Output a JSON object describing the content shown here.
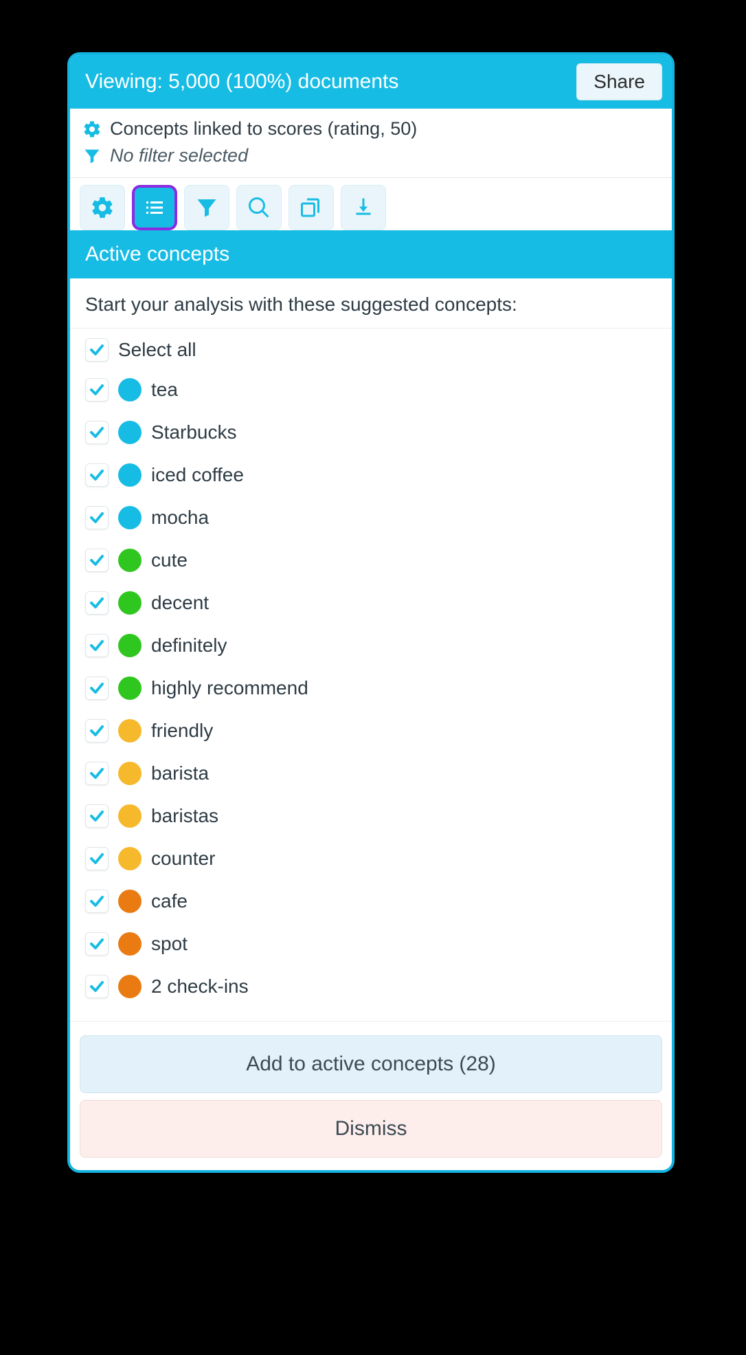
{
  "topbar": {
    "viewing_label": "Viewing: 5,000 (100%) documents",
    "share_label": "Share"
  },
  "status": {
    "concepts_linked": "Concepts linked to scores (rating, 50)",
    "filter": "No filter selected"
  },
  "section": {
    "title": "Active concepts",
    "intro": "Start your analysis with these suggested concepts:"
  },
  "select_all_label": "Select all",
  "footer": {
    "add_label": "Add to active concepts (28)",
    "dismiss_label": "Dismiss"
  },
  "colors": {
    "blue": "#17bce4",
    "green": "#2fc71f",
    "yellow": "#f5b92b",
    "orange": "#ea7b12"
  },
  "concepts": [
    {
      "label": "tea",
      "color": "blue"
    },
    {
      "label": "Starbucks",
      "color": "blue"
    },
    {
      "label": "iced coffee",
      "color": "blue"
    },
    {
      "label": "mocha",
      "color": "blue"
    },
    {
      "label": "cute",
      "color": "green"
    },
    {
      "label": "decent",
      "color": "green"
    },
    {
      "label": "definitely",
      "color": "green"
    },
    {
      "label": "highly recommend",
      "color": "green"
    },
    {
      "label": "friendly",
      "color": "yellow"
    },
    {
      "label": "barista",
      "color": "yellow"
    },
    {
      "label": "baristas",
      "color": "yellow"
    },
    {
      "label": "counter",
      "color": "yellow"
    },
    {
      "label": "cafe",
      "color": "orange"
    },
    {
      "label": "spot",
      "color": "orange"
    },
    {
      "label": "2 check-ins",
      "color": "orange"
    }
  ]
}
